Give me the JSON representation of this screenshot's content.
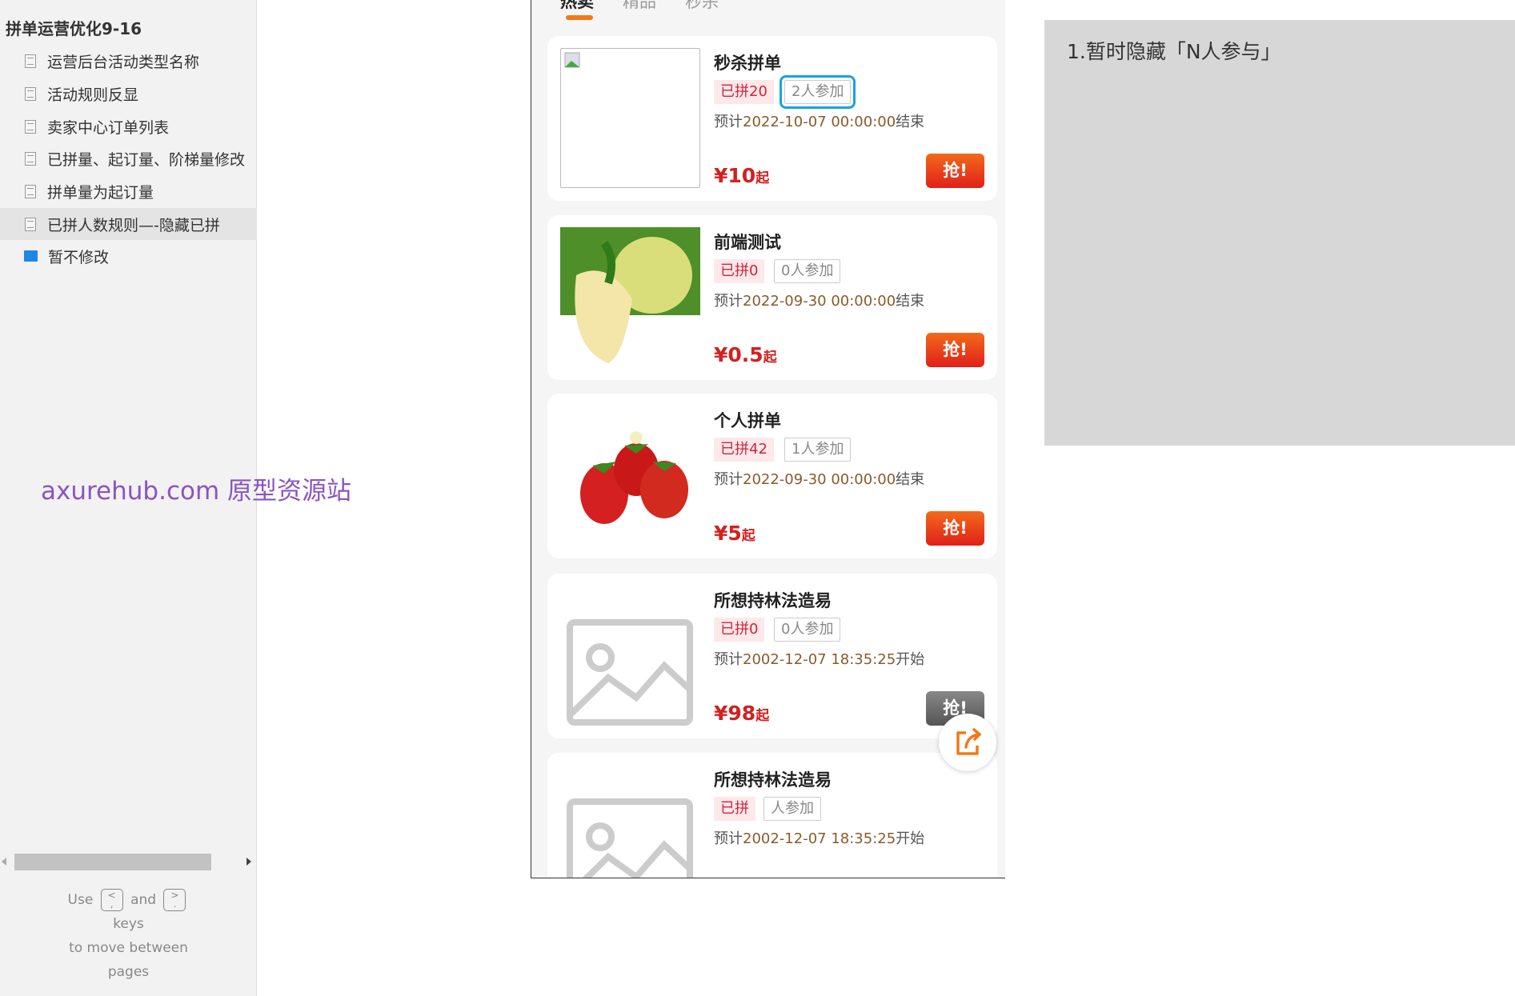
{
  "sidebar": {
    "title": "拼单运营优化9-16",
    "items": [
      {
        "label": "运营后台活动类型名称",
        "icon": "page-icon"
      },
      {
        "label": "活动规则反显",
        "icon": "page-icon"
      },
      {
        "label": "卖家中心订单列表",
        "icon": "page-icon"
      },
      {
        "label": "已拼量、起订量、阶梯量修改",
        "icon": "page-icon"
      },
      {
        "label": "拼单量为起订量",
        "icon": "page-icon"
      },
      {
        "label": "已拼人数规则—-隐藏已拼",
        "icon": "page-icon",
        "selected": true
      },
      {
        "label": "暂不修改",
        "icon": "folder-icon"
      }
    ],
    "help": {
      "use": "Use",
      "key1": "<\n,",
      "and": "and",
      "key2": ">\n.",
      "keys": "keys",
      "line3": "to move between",
      "line4": "pages"
    }
  },
  "watermark": "axurehub.com 原型资源站",
  "phone": {
    "tabs": [
      "热卖",
      "精品",
      "秒杀"
    ],
    "active_tab": 0,
    "accent": "#f07a1a",
    "products": [
      {
        "title": "秒杀拼单",
        "joined": "已拼20",
        "participants": "2人参加",
        "date_prefix": "预计",
        "date": "2022-10-07 00:00:00",
        "date_suffix": "结束",
        "price": "¥10",
        "price_suffix": "起",
        "buy": "抢!",
        "image": "broken-image"
      },
      {
        "title": "前端测试",
        "joined": "已拼0",
        "participants": "0人参加",
        "date_prefix": "预计",
        "date": "2022-09-30 00:00:00",
        "date_suffix": "结束",
        "price": "¥0.5",
        "price_suffix": "起",
        "buy": "抢!",
        "image": "pomelo"
      },
      {
        "title": "个人拼单",
        "joined": "已拼42",
        "participants": "1人参加",
        "date_prefix": "预计",
        "date": "2022-09-30 00:00:00",
        "date_suffix": "结束",
        "price": "¥5",
        "price_suffix": "起",
        "buy": "抢!",
        "image": "strawberries"
      },
      {
        "title": "所想持林法造易",
        "joined": "已拼0",
        "participants": "0人参加",
        "date_prefix": "预计",
        "date": "2002-12-07 18:35:25",
        "date_suffix": "开始",
        "price": "¥98",
        "price_suffix": "起",
        "buy": "抢!",
        "image": "placeholder-image",
        "disabled": true
      },
      {
        "title": "所想持林法造易",
        "joined": "已拼",
        "participants": "人参加",
        "date_prefix": "预计",
        "date": "2002-12-07 18:35:25",
        "date_suffix": "开始",
        "image": "placeholder-image"
      }
    ]
  },
  "note": {
    "text": "1.暂时隐藏「N人参与」"
  }
}
